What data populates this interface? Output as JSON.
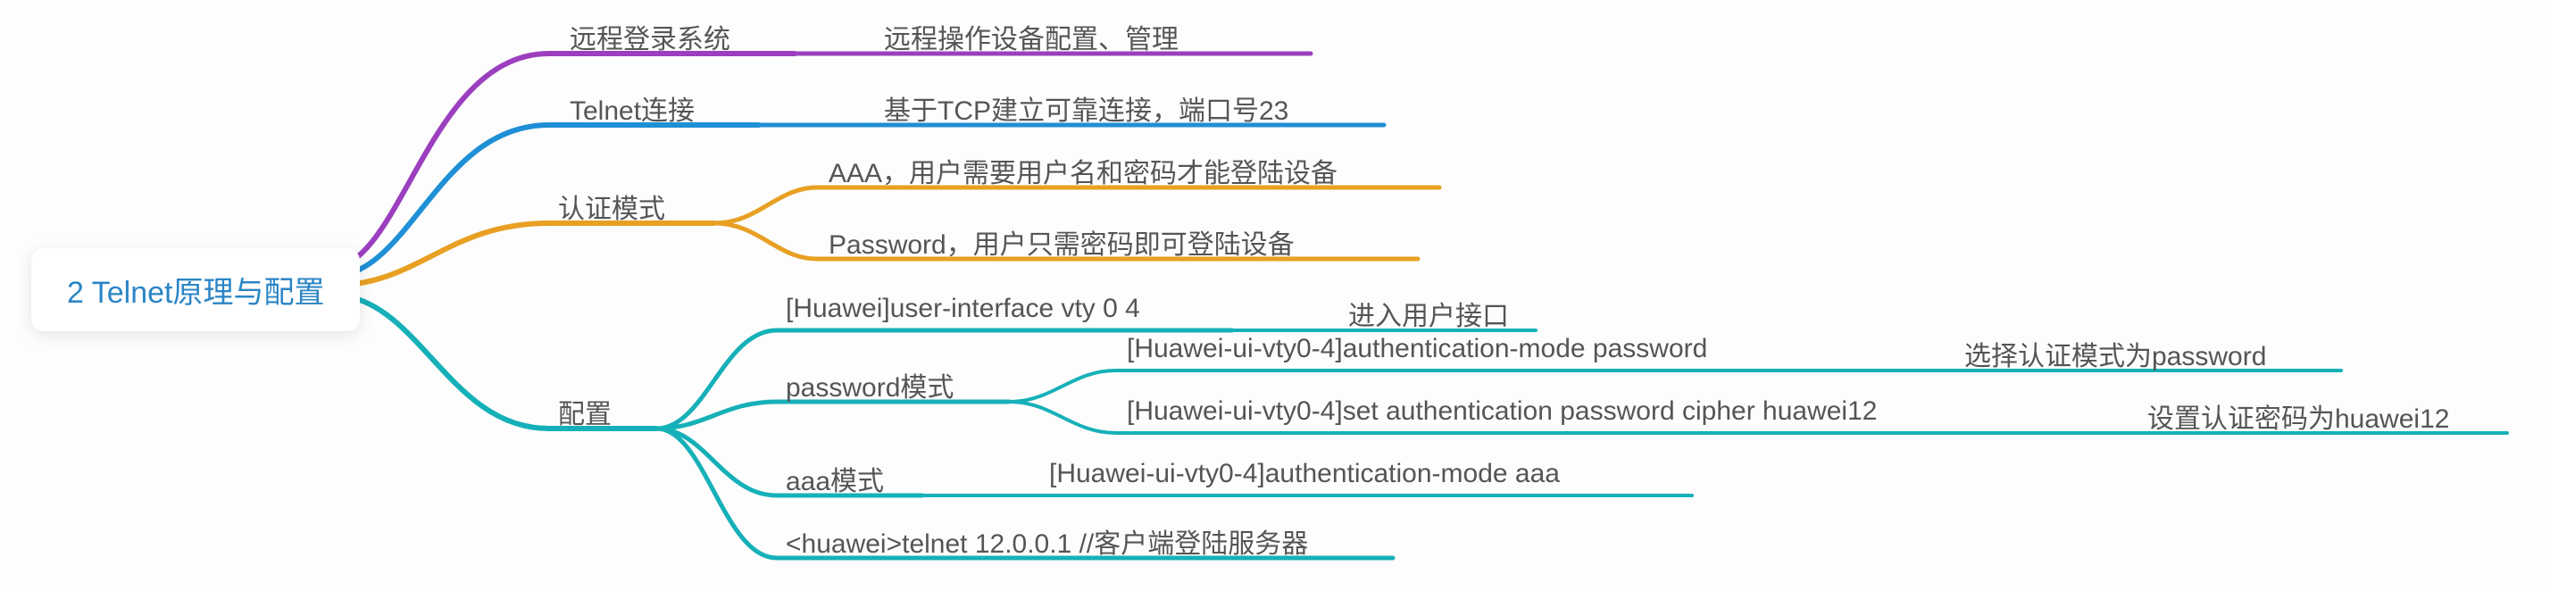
{
  "root": {
    "title": "2 Telnet原理与配置"
  },
  "branches": {
    "remote_login": {
      "label": "远程登录系统",
      "desc": "远程操作设备配置、管理"
    },
    "telnet_conn": {
      "label": "Telnet连接",
      "desc": "基于TCP建立可靠连接，端口号23"
    },
    "auth_mode": {
      "label": "认证模式",
      "children": {
        "aaa": "AAA，用户需要用户名和密码才能登陆设备",
        "password": "Password，用户只需密码即可登陆设备"
      }
    },
    "config": {
      "label": "配置",
      "children": {
        "user_interface": {
          "cmd": "[Huawei]user-interface vty 0 4",
          "desc": "进入用户接口"
        },
        "password_mode": {
          "label": "password模式",
          "children": {
            "auth_mode": {
              "cmd": "[Huawei-ui-vty0-4]authentication-mode password",
              "desc": "选择认证模式为password"
            },
            "set_password": {
              "cmd": "[Huawei-ui-vty0-4]set authentication password cipher huawei12",
              "desc": "设置认证密码为huawei12"
            }
          }
        },
        "aaa_mode": {
          "label": "aaa模式",
          "cmd": "[Huawei-ui-vty0-4]authentication-mode aaa"
        },
        "telnet_client": {
          "cmd": "<huawei>telnet 12.0.0.1   //客户端登陆服务器"
        }
      }
    }
  },
  "colors": {
    "purple": "#9b3fbf",
    "blue": "#1f8fd6",
    "orange": "#e8a023",
    "teal": "#16b0b8"
  }
}
